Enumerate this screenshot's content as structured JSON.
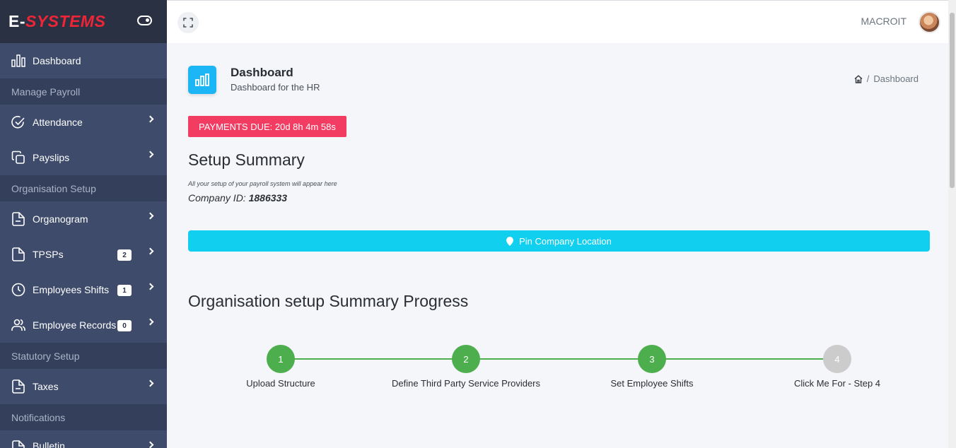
{
  "brand": {
    "prefix": "E-",
    "name": "SYSTEMS"
  },
  "sidebar": {
    "dashboard": "Dashboard",
    "sections": [
      "Manage Payroll",
      "Organisation Setup",
      "Statutory Setup",
      "Notifications"
    ],
    "items": [
      {
        "label": "Attendance"
      },
      {
        "label": "Payslips"
      },
      {
        "label": "Organogram"
      },
      {
        "label": "TPSPs",
        "badge": "2"
      },
      {
        "label": "Employees Shifts",
        "badge": "1"
      },
      {
        "label": "Employee Records",
        "badge": "0"
      },
      {
        "label": "Taxes"
      },
      {
        "label": "Bulletin"
      }
    ]
  },
  "topbar": {
    "user": "MACROIT"
  },
  "page": {
    "title": "Dashboard",
    "subtitle": "Dashboard for the HR",
    "breadcrumb": {
      "separator": "/",
      "current": "Dashboard"
    }
  },
  "payments_due": "PAYMENTS DUE: 20d 8h 4m 58s",
  "setup": {
    "heading": "Setup Summary",
    "note": "All your setup of your payroll system will appear here",
    "company_label": "Company ID:",
    "company_id": "1886333"
  },
  "pin_button": "Pin Company Location",
  "progress": {
    "heading": "Organisation setup Summary Progress",
    "steps": [
      {
        "number": "1",
        "label": "Upload Structure",
        "status": "complete"
      },
      {
        "number": "2",
        "label": "Define Third Party Service Providers",
        "status": "complete"
      },
      {
        "number": "3",
        "label": "Set Employee Shifts",
        "status": "complete"
      },
      {
        "number": "4",
        "label": "Click Me For - Step 4",
        "status": "pending"
      }
    ]
  },
  "colors": {
    "sidebar_bg": "#3e4b6b",
    "brand_accent": "#ee2537",
    "due_badge": "#f23c62",
    "pin_button": "#10cfef",
    "step_complete": "#4cae4c",
    "step_pending": "#cccccc"
  }
}
